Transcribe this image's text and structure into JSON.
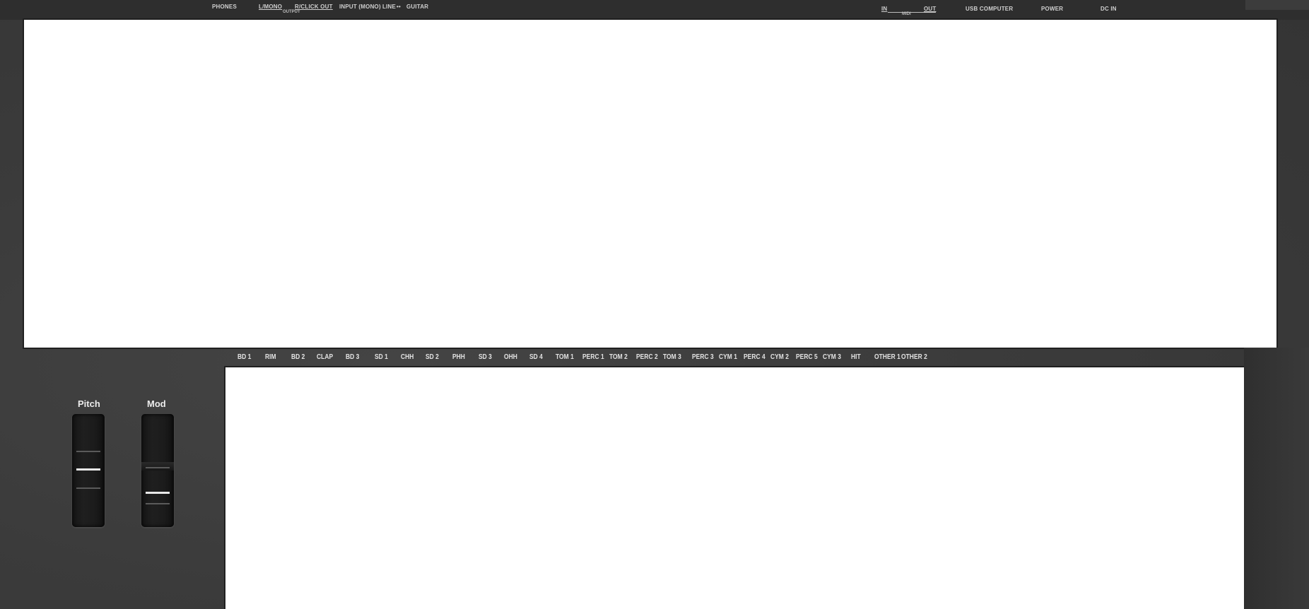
{
  "rear_panel": {
    "phones": "PHONES",
    "l_mono": "L/MONO",
    "r_click_out": "R/CLICK OUT",
    "output": "OUTPUT",
    "input_mono": "INPUT (MONO)",
    "line": "LINE",
    "guitar": "GUITAR",
    "midi_in": "IN",
    "midi_out": "OUT",
    "midi": "MIDI",
    "usb_computer": "USB COMPUTER",
    "power": "POWER",
    "dc_in": "DC IN"
  },
  "pad_labels": [
    "BD 1",
    "RIM",
    "BD 2",
    "CLAP",
    "BD 3",
    "SD 1",
    "CHH",
    "SD 2",
    "PHH",
    "SD 3",
    "OHH",
    "SD 4",
    "TOM 1",
    "PERC 1",
    "TOM 2",
    "PERC 2",
    "TOM 3",
    "PERC 3",
    "CYM 1",
    "PERC 4",
    "CYM 2",
    "PERC 5",
    "CYM 3",
    "HIT",
    "OTHER 1",
    "OTHER 2"
  ],
  "wheels": {
    "pitch": {
      "label": "Pitch",
      "position": 0.5
    },
    "mod": {
      "label": "Mod",
      "position": 0.0
    }
  },
  "colors": {
    "body": "#3a3a3a",
    "panel": "#ffffff",
    "label_text": "#e2e2e2"
  }
}
